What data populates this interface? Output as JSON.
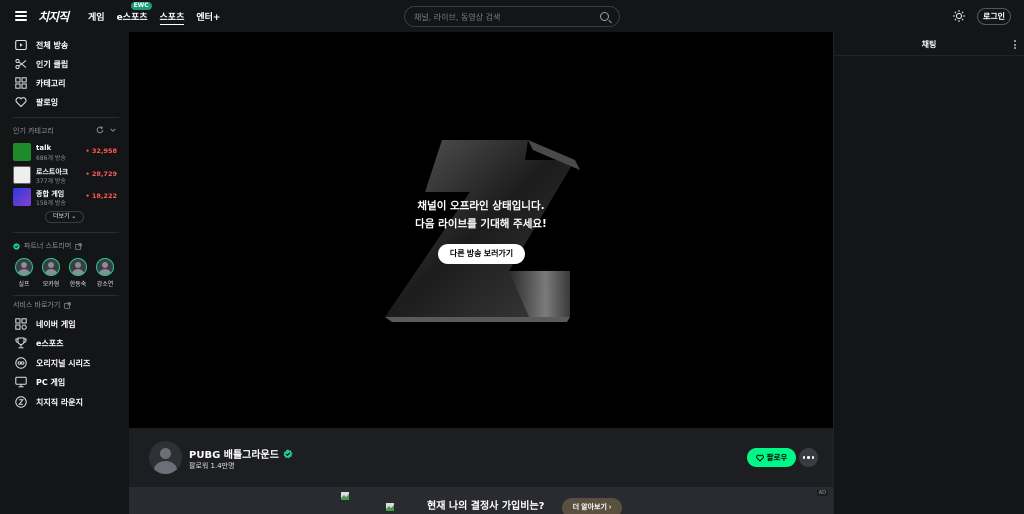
{
  "header": {
    "logo": "치지직",
    "nav": [
      {
        "label": "게임"
      },
      {
        "label": "e스포츠",
        "badge": "EWC"
      },
      {
        "label": "스포츠"
      },
      {
        "label": "엔터+"
      }
    ],
    "search_placeholder": "채널, 라이브, 동영상 검색",
    "login_label": "로그인"
  },
  "sidebar": {
    "main_items": [
      {
        "label": "전체 방송",
        "icon": "live-icon"
      },
      {
        "label": "인기 클립",
        "icon": "clip-icon"
      },
      {
        "label": "카테고리",
        "icon": "category-icon"
      },
      {
        "label": "팔로잉",
        "icon": "heart-icon"
      }
    ],
    "popular_categories": {
      "title": "인기 카테고리",
      "items": [
        {
          "name": "talk",
          "sub": "686개 방송",
          "count": "• 32,958"
        },
        {
          "name": "로스트아크",
          "sub": "377개 방송",
          "count": "• 28,729"
        },
        {
          "name": "종합 게임",
          "sub": "158개 방송",
          "count": "• 18,222"
        }
      ],
      "more_label": "더보기"
    },
    "partner_streamers": {
      "title": "파트너 스트리머",
      "items": [
        {
          "name": "실프"
        },
        {
          "name": "모카형"
        },
        {
          "name": "한동숙"
        },
        {
          "name": "강소연"
        }
      ]
    },
    "services": {
      "title": "서비스 바로가기",
      "items": [
        {
          "label": "네이버 게임",
          "icon": "grid-icon"
        },
        {
          "label": "e스포츠",
          "icon": "trophy-icon"
        },
        {
          "label": "오리지널 시리즈",
          "icon": "original-icon"
        },
        {
          "label": "PC 게임",
          "icon": "monitor-icon"
        },
        {
          "label": "치지직 라운지",
          "icon": "lounge-icon"
        }
      ]
    }
  },
  "player": {
    "offline_line1": "채널이 오프라인 상태입니다.",
    "offline_line2": "다음 라이브를 기대해 주세요!",
    "other_button": "다른 방송 보러가기"
  },
  "channel": {
    "name": "PUBG 배틀그라운드",
    "followers": "팔로워 1.4만명",
    "follow_label": "팔로우"
  },
  "ad": {
    "text": "현재 나의 결정사 가입비는?",
    "button": "더 알아보기 ›",
    "tag": "AD"
  },
  "chat": {
    "title": "채팅"
  },
  "colors": {
    "accent": "#00f889",
    "background": "#141517",
    "live_count": "#ff5a5a"
  }
}
